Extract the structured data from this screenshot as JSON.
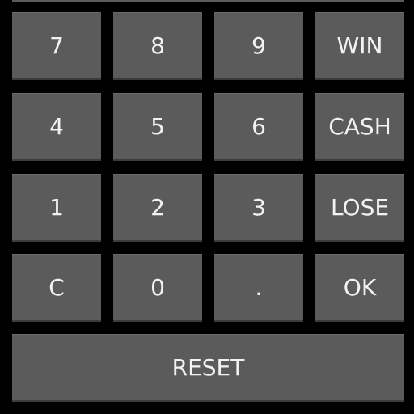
{
  "keypad": {
    "rows": [
      [
        "7",
        "8",
        "9",
        "WIN"
      ],
      [
        "4",
        "5",
        "6",
        "CASH"
      ],
      [
        "1",
        "2",
        "3",
        "LOSE"
      ],
      [
        "C",
        "0",
        ".",
        "OK"
      ]
    ],
    "reset_label": "RESET"
  },
  "colors": {
    "background": "#000000",
    "key_face": "#5b5b5b",
    "key_text": "#f2f2f2"
  }
}
